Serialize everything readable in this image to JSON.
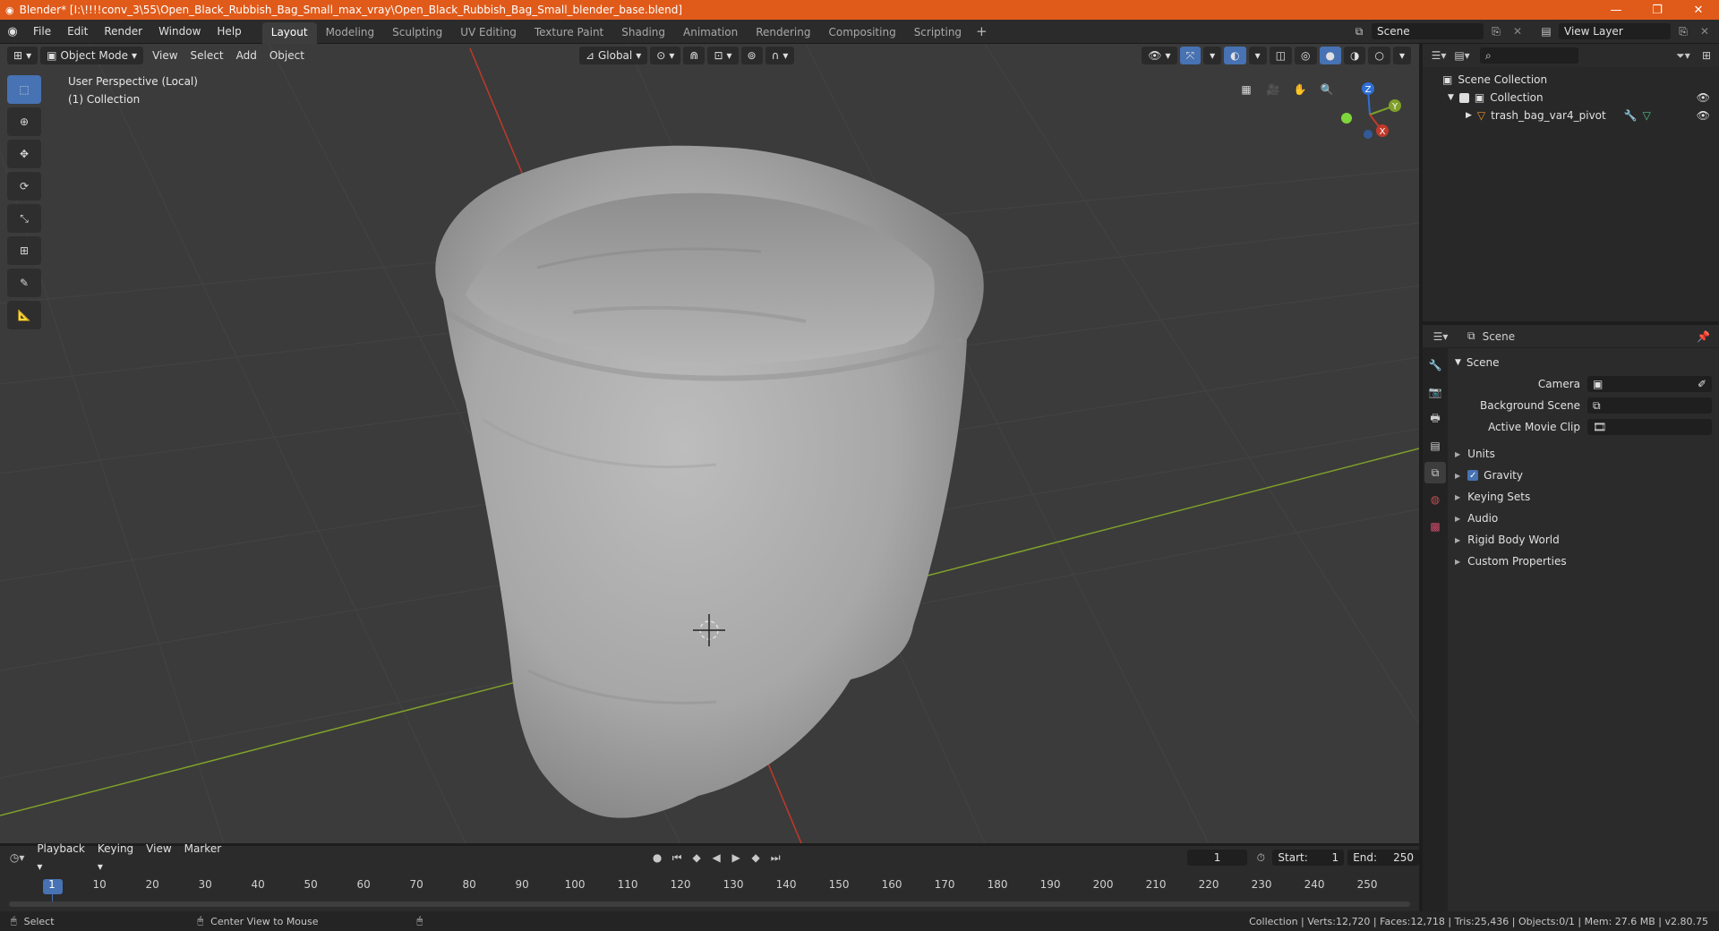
{
  "titlebar": {
    "title": "Blender* [I:\\!!!!conv_3\\55\\Open_Black_Rubbish_Bag_Small_max_vray\\Open_Black_Rubbish_Bag_Small_blender_base.blend]",
    "minimize": "—",
    "maximize": "❐",
    "close": "✕"
  },
  "topbar": {
    "menus": [
      "File",
      "Edit",
      "Render",
      "Window",
      "Help"
    ],
    "workspaces": [
      "Layout",
      "Modeling",
      "Sculpting",
      "UV Editing",
      "Texture Paint",
      "Shading",
      "Animation",
      "Rendering",
      "Compositing",
      "Scripting"
    ],
    "active_workspace": "Layout",
    "add_workspace": "+",
    "scene_name": "Scene",
    "view_layer": "View Layer"
  },
  "viewport": {
    "mode": "Object Mode",
    "menus": [
      "View",
      "Select",
      "Add",
      "Object"
    ],
    "orientation": "Global",
    "perspective_label": "User Perspective (Local)",
    "collection_label": "(1) Collection",
    "gizmo": {
      "x": "X",
      "y": "Y",
      "z": "Z"
    }
  },
  "outliner": {
    "search_placeholder": "",
    "scene_collection": "Scene Collection",
    "collection": "Collection",
    "object": "trash_bag_var4_pivot"
  },
  "properties": {
    "context": "Scene",
    "panel_title": "Scene",
    "camera_label": "Camera",
    "background_scene_label": "Background Scene",
    "active_movie_clip_label": "Active Movie Clip",
    "sections": [
      "Units",
      "Gravity",
      "Keying Sets",
      "Audio",
      "Rigid Body World",
      "Custom Properties"
    ],
    "gravity_checked": true
  },
  "timeline": {
    "menus": [
      "Playback",
      "Keying",
      "View",
      "Marker"
    ],
    "current_frame": "1",
    "start_label": "Start:",
    "start": "1",
    "end_label": "End:",
    "end": "250",
    "ticks": [
      "1",
      "10",
      "20",
      "30",
      "40",
      "50",
      "60",
      "70",
      "80",
      "90",
      "100",
      "110",
      "120",
      "130",
      "140",
      "150",
      "160",
      "170",
      "180",
      "190",
      "200",
      "210",
      "220",
      "230",
      "240",
      "250"
    ]
  },
  "statusbar": {
    "select": "Select",
    "center_view": "Center View to Mouse",
    "stats": "Collection | Verts:12,720 | Faces:12,718 | Tris:25,436 | Objects:0/1 | Mem: 27.6 MB | v2.80.75"
  },
  "colors": {
    "titlebar": "#e05a1a",
    "accent": "#4772b3",
    "x_axis": "#c0392b",
    "y_axis": "#7fa02a",
    "z_axis": "#2f6fd6"
  }
}
